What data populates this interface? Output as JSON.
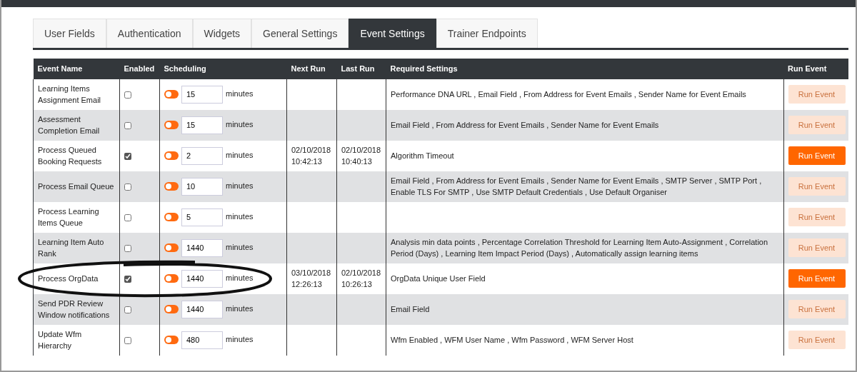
{
  "tabs": [
    {
      "label": "User Fields",
      "selected": false
    },
    {
      "label": "Authentication",
      "selected": false
    },
    {
      "label": "Widgets",
      "selected": false
    },
    {
      "label": "General Settings",
      "selected": false
    },
    {
      "label": "Event Settings",
      "selected": true
    },
    {
      "label": "Trainer Endpoints",
      "selected": false
    }
  ],
  "table": {
    "columns": [
      "Event Name",
      "Enabled",
      "Scheduling",
      "Next Run",
      "Last Run",
      "Required Settings",
      "Run Event"
    ],
    "rows": [
      {
        "event_name": "Learning Items Assignment Email",
        "enabled": false,
        "schedule_on": false,
        "interval": "15",
        "unit": "minutes",
        "next_run": "",
        "last_run": "",
        "required_settings": "Performance DNA URL , Email Field , From Address for Event Emails , Sender Name for Event Emails",
        "button": "Run Event",
        "button_disabled": true,
        "circled": false
      },
      {
        "event_name": "Assessment Completion Email",
        "enabled": false,
        "schedule_on": false,
        "interval": "15",
        "unit": "minutes",
        "next_run": "",
        "last_run": "",
        "required_settings": "Email Field , From Address for Event Emails , Sender Name for Event Emails",
        "button": "Run Event",
        "button_disabled": true,
        "circled": false
      },
      {
        "event_name": "Process Queued Booking Requests",
        "enabled": true,
        "schedule_on": false,
        "interval": "2",
        "unit": "minutes",
        "next_run": "02/10/2018 10:42:13",
        "last_run": "02/10/2018 10:40:13",
        "required_settings": "Algorithm Timeout",
        "button": "Run Event",
        "button_disabled": false,
        "circled": false
      },
      {
        "event_name": "Process Email Queue",
        "enabled": false,
        "schedule_on": false,
        "interval": "10",
        "unit": "minutes",
        "next_run": "",
        "last_run": "",
        "required_settings": "Email Field , From Address for Event Emails , Sender Name for Event Emails , SMTP Server , SMTP Port , Enable TLS For SMTP , Use SMTP Default Credentials , Use Default Organiser",
        "button": "Run Event",
        "button_disabled": true,
        "circled": false
      },
      {
        "event_name": "Process Learning Items Queue",
        "enabled": false,
        "schedule_on": false,
        "interval": "5",
        "unit": "minutes",
        "next_run": "",
        "last_run": "",
        "required_settings": "",
        "button": "Run Event",
        "button_disabled": true,
        "circled": false
      },
      {
        "event_name": "Learning Item Auto Rank",
        "enabled": false,
        "schedule_on": false,
        "interval": "1440",
        "unit": "minutes",
        "next_run": "",
        "last_run": "",
        "required_settings": "Analysis min data points , Percentage Correlation Threshold for Learning Item Auto-Assignment , Correlation Period (Days) , Learning Item Impact Period (Days) , Automatically assign learning items",
        "button": "Run Event",
        "button_disabled": true,
        "circled": false
      },
      {
        "event_name": "Process OrgData",
        "enabled": true,
        "schedule_on": false,
        "interval": "1440",
        "unit": "minutes",
        "next_run": "03/10/2018 12:26:13",
        "last_run": "02/10/2018 10:26:13",
        "required_settings": "OrgData Unique User Field",
        "button": "Run Event",
        "button_disabled": false,
        "circled": true
      },
      {
        "event_name": "Send PDR Review Window notifications",
        "enabled": false,
        "schedule_on": false,
        "interval": "1440",
        "unit": "minutes",
        "next_run": "",
        "last_run": "",
        "required_settings": "Email Field",
        "button": "Run Event",
        "button_disabled": true,
        "circled": false
      },
      {
        "event_name": "Update Wfm Hierarchy",
        "enabled": false,
        "schedule_on": false,
        "interval": "480",
        "unit": "minutes",
        "next_run": "",
        "last_run": "",
        "required_settings": "Wfm Enabled , WFM User Name , Wfm Password , WFM Server Host",
        "button": "Run Event",
        "button_disabled": true,
        "circled": false
      }
    ]
  }
}
